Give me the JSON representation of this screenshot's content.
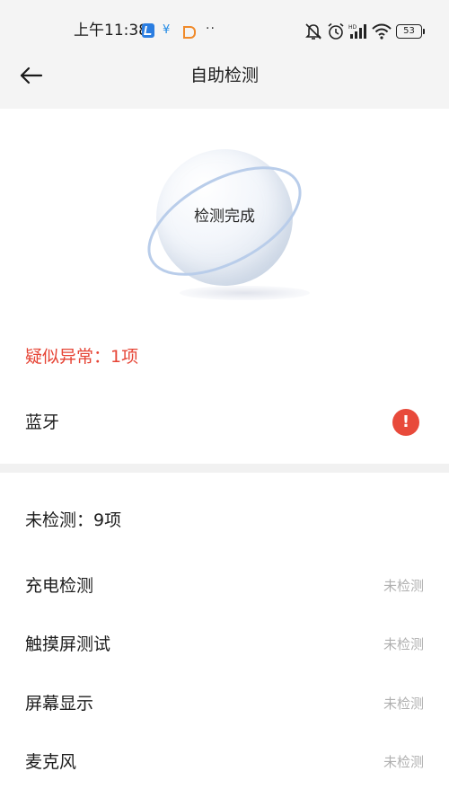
{
  "status_bar": {
    "time": "上午11:38",
    "notif_symbol": "¥",
    "more": "··",
    "battery": "53"
  },
  "header": {
    "title": "自助检测"
  },
  "orb": {
    "label": "检测完成"
  },
  "anomaly": {
    "title": "疑似异常：1项",
    "items": [
      {
        "label": "蓝牙",
        "alert_glyph": "!"
      }
    ]
  },
  "untested": {
    "title": "未检测：9项",
    "items": [
      {
        "label": "充电检测",
        "status": "未检测"
      },
      {
        "label": "触摸屏测试",
        "status": "未检测"
      },
      {
        "label": "屏幕显示",
        "status": "未检测"
      },
      {
        "label": "麦克风",
        "status": "未检测"
      }
    ]
  },
  "colors": {
    "accent_red": "#e64435",
    "header_bg": "#f4f4f4",
    "muted_status": "#b0b0b0"
  },
  "icons": {
    "back": "arrow-left-icon",
    "mute": "bell-slash-icon",
    "alarm": "alarm-clock-icon",
    "signal": "signal-bars-icon",
    "wifi": "wifi-icon",
    "battery": "battery-icon",
    "alert": "exclamation-circle-icon"
  }
}
